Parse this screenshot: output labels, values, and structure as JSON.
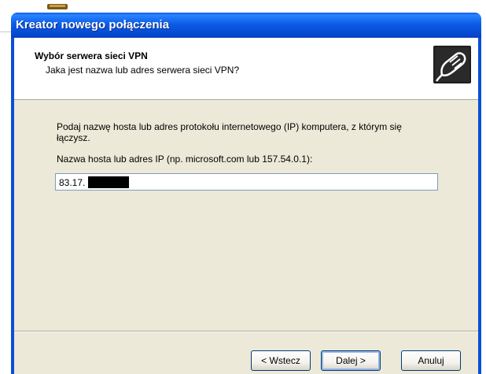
{
  "window": {
    "title": "Kreator nowego połączenia"
  },
  "header": {
    "title": "Wybór serwera sieci VPN",
    "subtitle": "Jaka jest nazwa lub adres serwera sieci VPN?",
    "icon": "network-cable-icon"
  },
  "body": {
    "prompt": "Podaj nazwę hosta lub adres protokołu internetowego (IP) komputera, z którym się łączysz.",
    "field_label": "Nazwa hosta lub adres IP (np. microsoft.com lub 157.54.0.1):",
    "host_value_visible": "83.17."
  },
  "buttons": {
    "back": "< Wstecz",
    "next": "Dalej >",
    "cancel": "Anuluj"
  },
  "colors": {
    "titlebar": "#0a5ee8",
    "dialog_face": "#ece9d8",
    "input_border": "#7f9db9"
  }
}
